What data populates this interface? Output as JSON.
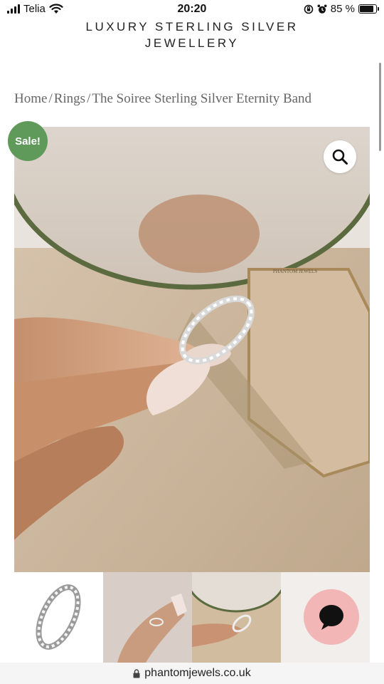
{
  "status": {
    "carrier": "Telia",
    "time": "20:20",
    "battery": "85 %",
    "battery_level": 0.85
  },
  "header": {
    "brand_line1": "LUXURY STERLING SILVER",
    "brand_line2": "JEWELLERY"
  },
  "breadcrumb": {
    "items": [
      "Home",
      "Rings",
      "The Soiree Sterling Silver Eternity Band"
    ],
    "separator": "/"
  },
  "product": {
    "sale_badge": "Sale!",
    "image_watermark": "PHANTOM JEWELS",
    "thumbnail_count": 4
  },
  "icons": {
    "zoom": "search-icon",
    "chat": "chat-bubble-icon",
    "lock": "lock-icon"
  },
  "colors": {
    "sale_badge": "#5f9a5a",
    "chat_button": "#f2b6b6"
  },
  "browser": {
    "url": "phantomjewels.co.uk"
  }
}
